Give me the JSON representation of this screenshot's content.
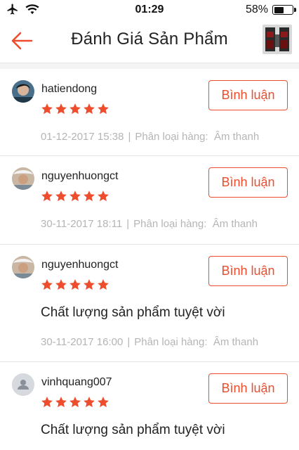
{
  "status_bar": {
    "time": "01:29",
    "battery": "58%",
    "battery_level": 0.58
  },
  "header": {
    "title": "Đánh Giá Sản Phẩm"
  },
  "accent_color": "#ee4d2d",
  "reviews": [
    {
      "username": "hatiendong",
      "rating": 5,
      "comment": "",
      "date": "01-12-2017 15:38",
      "sep": "|",
      "variant_label": "Phân loại hàng:",
      "variant_value": "Âm thanh",
      "button_label": "Bình luận",
      "avatar": "photo-avatar-icon"
    },
    {
      "username": "nguyenhuongct",
      "rating": 5,
      "comment": "",
      "date": "30-11-2017 18:11",
      "sep": "|",
      "variant_label": "Phân loại hàng:",
      "variant_value": "Âm thanh",
      "button_label": "Bình luận",
      "avatar": "photo-avatar-icon"
    },
    {
      "username": "nguyenhuongct",
      "rating": 5,
      "comment": "Chất lượng sản phẩm tuyệt vời",
      "date": "30-11-2017 16:00",
      "sep": "|",
      "variant_label": "Phân loại hàng:",
      "variant_value": "Âm thanh",
      "button_label": "Bình luận",
      "avatar": "photo-avatar-icon"
    },
    {
      "username": "vinhquang007",
      "rating": 5,
      "comment": "Chất lượng sản phẩm tuyệt vời",
      "date": "",
      "sep": "",
      "variant_label": "",
      "variant_value": "",
      "button_label": "Bình luận",
      "avatar": "default-user-icon"
    }
  ]
}
